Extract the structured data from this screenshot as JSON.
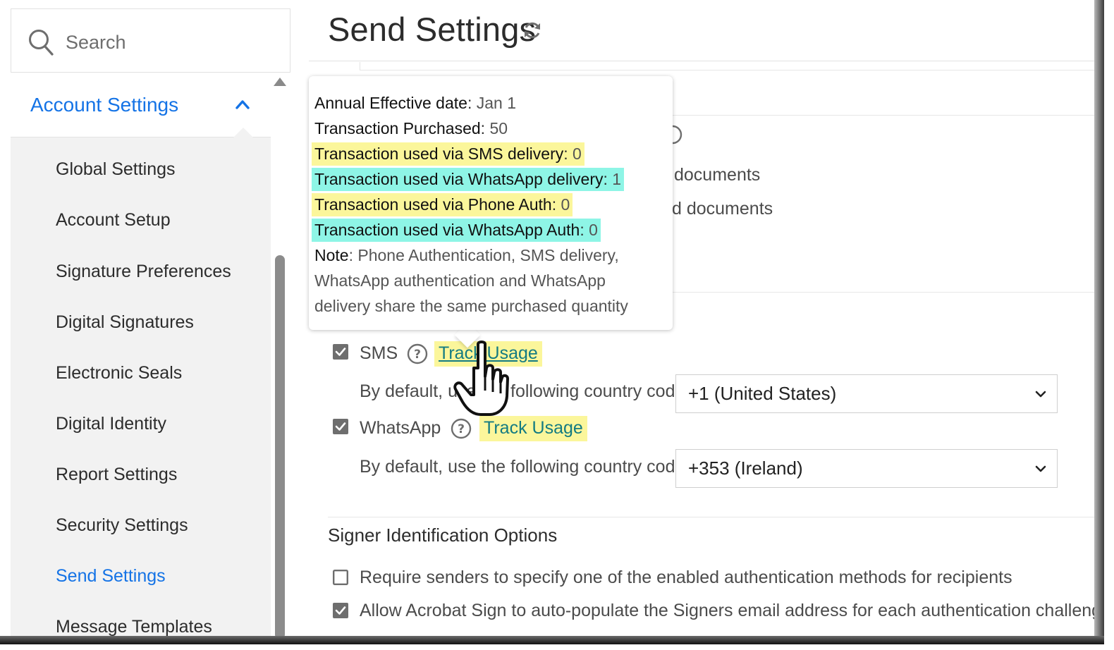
{
  "sidebar": {
    "search_placeholder": "Search",
    "section_title": "Account Settings",
    "items": [
      {
        "label": "Global Settings",
        "active": false
      },
      {
        "label": "Account Setup",
        "active": false
      },
      {
        "label": "Signature Preferences",
        "active": false
      },
      {
        "label": "Digital Signatures",
        "active": false
      },
      {
        "label": "Electronic Seals",
        "active": false
      },
      {
        "label": "Digital Identity",
        "active": false
      },
      {
        "label": "Report Settings",
        "active": false
      },
      {
        "label": "Security Settings",
        "active": false
      },
      {
        "label": "Send Settings",
        "active": true
      },
      {
        "label": "Message Templates",
        "active": false
      }
    ]
  },
  "main": {
    "title": "Send Settings",
    "bg_text_1": "documents",
    "bg_text_2": "d documents",
    "sms": {
      "checked": true,
      "label": "SMS",
      "track_label": "Track Usage",
      "country_prompt": "By default, use the following country code:",
      "country_value": "+1 (United States)"
    },
    "whatsapp": {
      "checked": true,
      "label": "WhatsApp",
      "track_label": "Track Usage",
      "country_prompt": "By default, use the following country code:",
      "country_value": "+353 (Ireland)"
    },
    "signer_section": {
      "heading": "Signer Identification Options",
      "options": [
        {
          "checked": false,
          "label": "Require senders to specify one of the enabled authentication methods for recipients"
        },
        {
          "checked": true,
          "label": "Allow Acrobat Sign to auto-populate the Signers email address for each authentication challenge"
        }
      ]
    }
  },
  "tooltip": {
    "lines": [
      {
        "key": "Annual Effective date",
        "value": "Jan 1",
        "highlight": "none"
      },
      {
        "key": "Transaction Purchased",
        "value": "50",
        "highlight": "none"
      },
      {
        "key": "Transaction used via SMS delivery",
        "value": "0",
        "highlight": "yellow"
      },
      {
        "key": "Transaction used via WhatsApp delivery",
        "value": "1",
        "highlight": "cyan"
      },
      {
        "key": "Transaction used via Phone Auth",
        "value": "0",
        "highlight": "yellow"
      },
      {
        "key": "Transaction used via WhatsApp Auth",
        "value": "0",
        "highlight": "cyan"
      }
    ],
    "note_key": "Note",
    "note_lines": [
      "Phone Authentication, SMS delivery,",
      "WhatsApp authentication and WhatsApp",
      "delivery share the same purchased quantity"
    ]
  },
  "colors": {
    "accent": "#1473e6",
    "link": "#137b82",
    "highlight_yellow": "#fbf69b",
    "highlight_cyan": "#8ef5e6"
  }
}
